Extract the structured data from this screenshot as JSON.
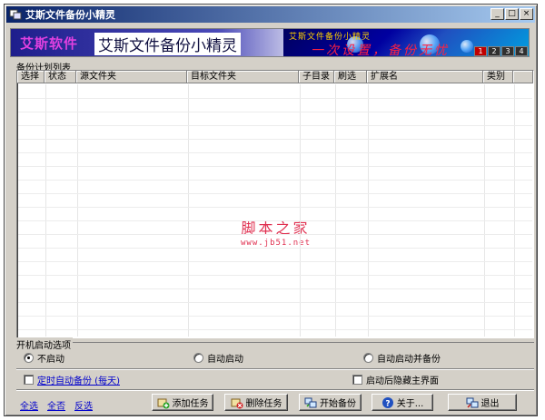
{
  "window": {
    "title": "艾斯文件备份小精灵",
    "minimize_glyph": "_",
    "maximize_glyph": "□",
    "close_glyph": "×"
  },
  "banner": {
    "logo_text": "艾斯软件",
    "app_name": "艾斯文件备份小精灵",
    "slogan_line1": "艾斯文件备份小精灵",
    "slogan_line2": "一次设置，备份无忧",
    "tabs": [
      "1",
      "2",
      "3",
      "4"
    ],
    "active_tab": "1"
  },
  "task_list": {
    "label": "备份计划列表",
    "columns": [
      "选择",
      "状态",
      "源文件夹",
      "目标文件夹",
      "子目录",
      "刷选",
      "扩展名",
      "类别"
    ],
    "rows": []
  },
  "watermark": {
    "text": "脚本之家",
    "url": "www.jb51.net"
  },
  "startup": {
    "group_title": "开机启动选项",
    "options": [
      "不启动",
      "自动启动",
      "自动启动并备份"
    ],
    "selected": "不启动"
  },
  "options": {
    "scheduled_backup_label": "定时自动备份 (每天)",
    "scheduled_backup_checked": false,
    "hide_main_label": "启动后隐藏主界面",
    "hide_main_checked": false
  },
  "quick_links": {
    "select_all": "全选",
    "select_none": "全否",
    "invert": "反选"
  },
  "buttons": {
    "add_task": "添加任务",
    "delete_task": "删除任务",
    "start_backup": "开始备份",
    "about": "关于...",
    "exit": "退出"
  },
  "colors": {
    "face": "#d4d0c8",
    "title_start": "#0a246a",
    "title_end": "#a6caf0",
    "link": "#0000cc",
    "watermark": "#e03050"
  }
}
